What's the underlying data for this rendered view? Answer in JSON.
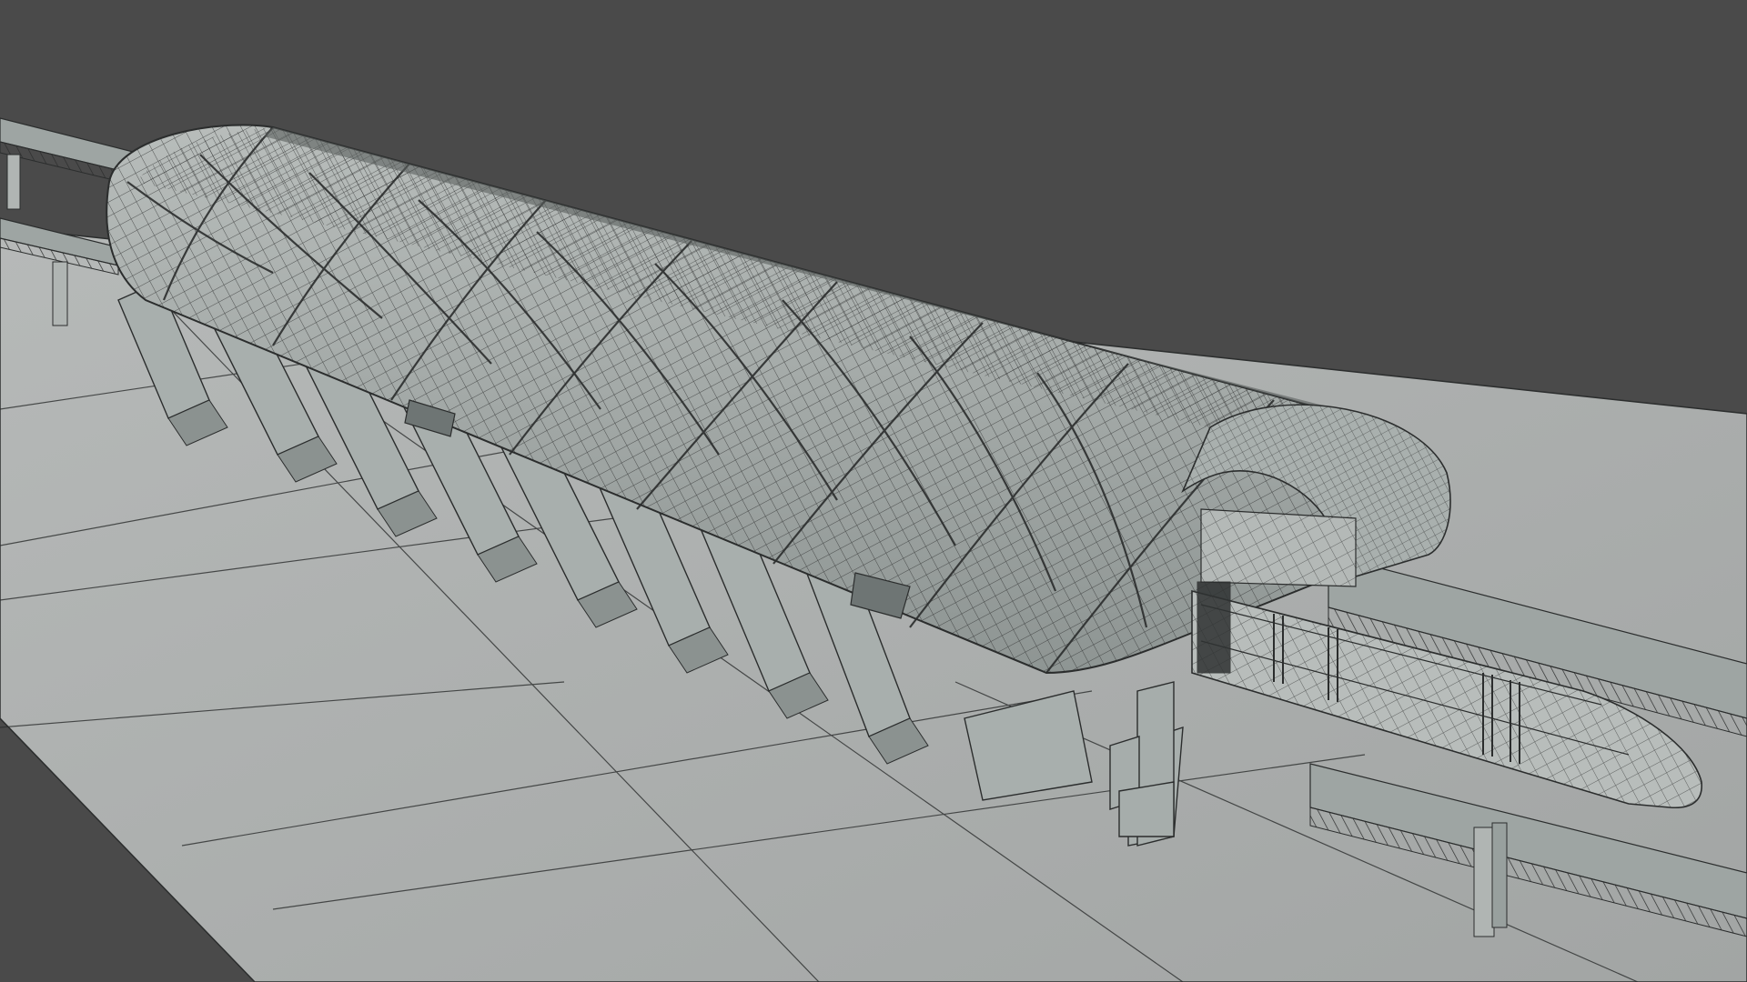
{
  "scene": {
    "subject": "wireframe-station-render",
    "colors": {
      "background": "#4a4a4a",
      "ground": "#a6a9a8",
      "ground_light": "#b3b6b5",
      "structure": "#9ea5a3",
      "structure_dark": "#7f8785",
      "wire": "#2b2d2d"
    }
  }
}
